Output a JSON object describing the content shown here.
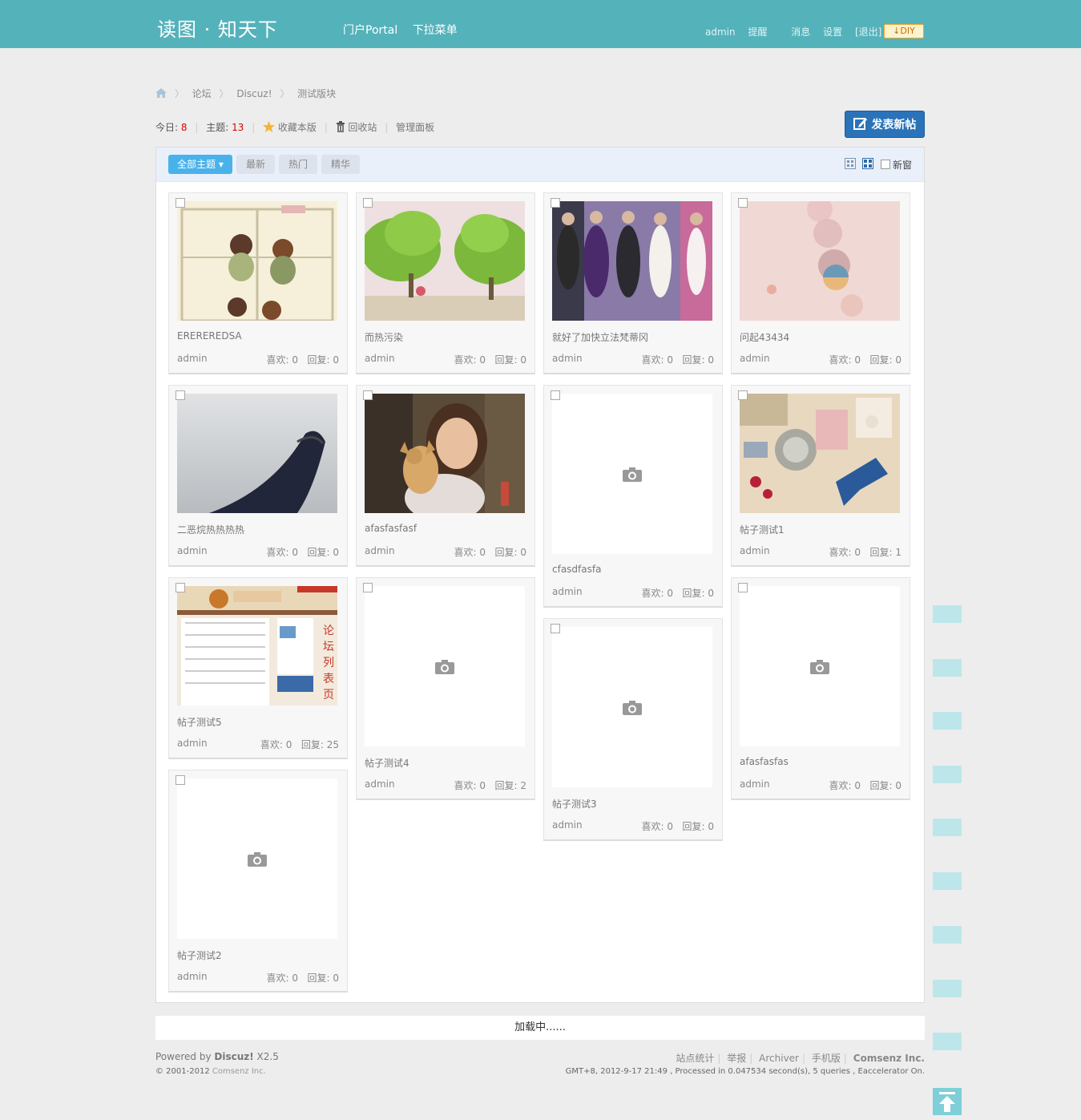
{
  "header": {
    "logo": "读图 · 知天下",
    "nav": [
      "门户Portal",
      "下拉菜单"
    ],
    "user": "admin",
    "links": [
      "提醒",
      "消息",
      "设置",
      "[退出]"
    ],
    "diy": "DIY"
  },
  "breadcrumb": [
    "论坛",
    "Discuz!",
    "测试版块"
  ],
  "stats": {
    "today_label": "今日: ",
    "today": "8",
    "threads_label": "主题: ",
    "threads": "13",
    "favorite": "收藏本版",
    "recycle": "回收站",
    "manage": "管理面板"
  },
  "new_post": "发表新帖",
  "tabs": [
    "全部主题",
    "最新",
    "热门",
    "精华"
  ],
  "new_window": "新窗",
  "cards": [
    {
      "title": "EREREREDSA",
      "author": "admin",
      "likes_label": "喜欢: 0",
      "replies_label": "回复: 0"
    },
    {
      "title": "而热污染",
      "author": "admin",
      "likes_label": "喜欢: 0",
      "replies_label": "回复: 0"
    },
    {
      "title": "就好了加快立法梵蒂冈",
      "author": "admin",
      "likes_label": "喜欢: 0",
      "replies_label": "回复: 0"
    },
    {
      "title": "问起43434",
      "author": "admin",
      "likes_label": "喜欢: 0",
      "replies_label": "回复: 0"
    },
    {
      "title": "二恶烷热热热热",
      "author": "admin",
      "likes_label": "喜欢: 0",
      "replies_label": "回复: 0"
    },
    {
      "title": "afasfasfasf",
      "author": "admin",
      "likes_label": "喜欢: 0",
      "replies_label": "回复: 0"
    },
    {
      "title": "cfasdfasfa",
      "author": "admin",
      "likes_label": "喜欢: 0",
      "replies_label": "回复: 0"
    },
    {
      "title": "帖子测试1",
      "author": "admin",
      "likes_label": "喜欢: 0",
      "replies_label": "回复: 1"
    },
    {
      "title": "帖子测试5",
      "author": "admin",
      "likes_label": "喜欢: 0",
      "replies_label": "回复: 25"
    },
    {
      "title": "帖子测试4",
      "author": "admin",
      "likes_label": "喜欢: 0",
      "replies_label": "回复: 2"
    },
    {
      "title": "帖子测试3",
      "author": "admin",
      "likes_label": "喜欢: 0",
      "replies_label": "回复: 0"
    },
    {
      "title": "afasfasfas",
      "author": "admin",
      "likes_label": "喜欢: 0",
      "replies_label": "回复: 0"
    },
    {
      "title": "帖子测试2",
      "author": "admin",
      "likes_label": "喜欢: 0",
      "replies_label": "回复: 0"
    }
  ],
  "loading": "加载中......",
  "footer": {
    "powered_prefix": "Powered by ",
    "powered_brand": "Discuz!",
    "powered_version": " X2.5",
    "copyright": "© 2001-2012 ",
    "company_small": "Comsenz Inc.",
    "links": [
      "站点统计",
      "举报",
      "Archiver",
      "手机版"
    ],
    "company": "Comsenz Inc.",
    "status": "GMT+8, 2012-9-17 21:49 , Processed in 0.047534 second(s), 5 queries , Eaccelerator On."
  },
  "icons": [
    "home-icon",
    "star-icon",
    "trash-icon",
    "edit-icon",
    "camera-icon",
    "grid-view-icon",
    "waterfall-view-icon",
    "back-to-top-icon"
  ],
  "colors": {
    "topbar": "#54b2ba",
    "accent": "#2a73b9",
    "tab_active": "#4ab2ea",
    "highlight": "#dd0000"
  }
}
